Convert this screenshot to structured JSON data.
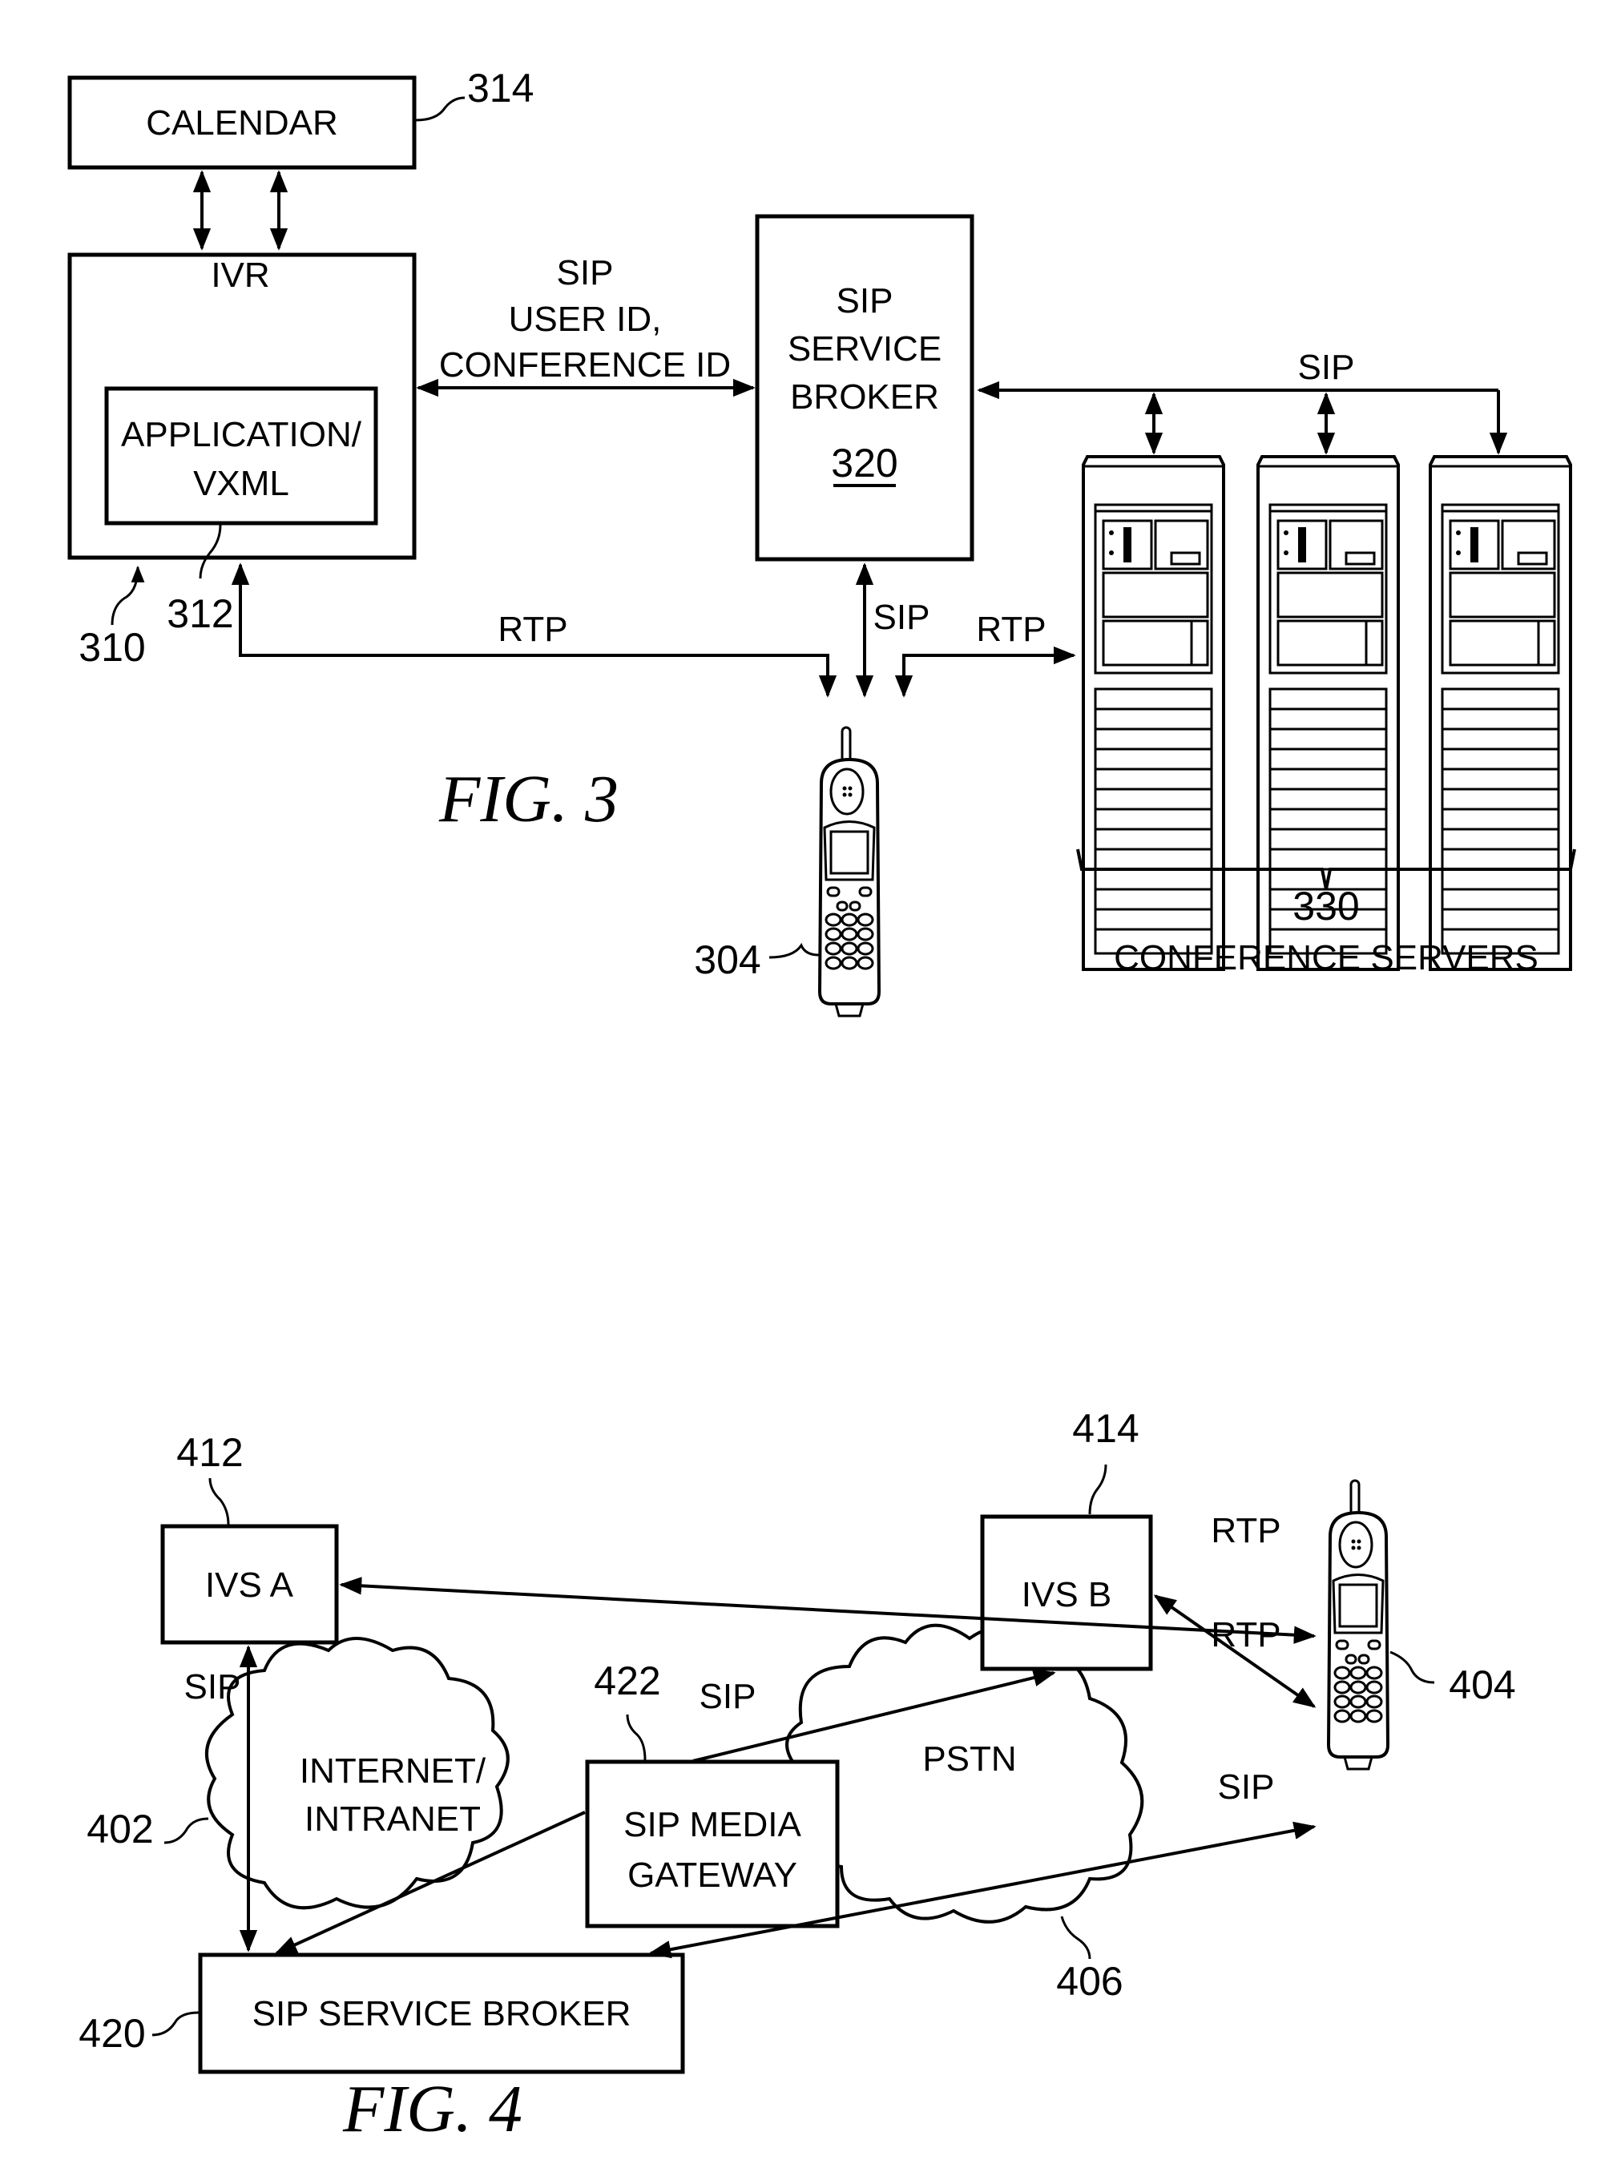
{
  "fig3": {
    "caption": "FIG. 3",
    "calendar": {
      "label": "CALENDAR",
      "ref": "314"
    },
    "ivr": {
      "title": "IVR",
      "ref": "310",
      "app_line1": "APPLICATION/",
      "app_line2": "VXML",
      "app_ref": "312"
    },
    "ivr_broker_link": {
      "line1": "SIP",
      "line2": "USER ID,",
      "line3": "CONFERENCE ID"
    },
    "broker": {
      "line1": "SIP",
      "line2": "SERVICE",
      "line3": "BROKER",
      "ref": "320"
    },
    "broker_servers_link": "SIP",
    "rtp_ivr_label": "RTP",
    "sip_phone_label": "SIP",
    "rtp_servers_label": "RTP",
    "phone": {
      "ref": "304"
    },
    "servers": {
      "ref": "330",
      "label": "CONFERENCE SERVERS",
      "count": 3
    }
  },
  "fig4": {
    "caption": "FIG. 4",
    "ivs_a": {
      "label": "IVS A",
      "ref": "412"
    },
    "ivs_b": {
      "label": "IVS B",
      "ref": "414"
    },
    "internet": {
      "line1": "INTERNET/",
      "line2": "INTRANET",
      "ref": "402"
    },
    "pstn": {
      "label": "PSTN",
      "ref": "406"
    },
    "gateway": {
      "line1": "SIP MEDIA",
      "line2": "GATEWAY",
      "ref": "422"
    },
    "broker": {
      "label": "SIP SERVICE BROKER",
      "ref": "420"
    },
    "phone": {
      "ref": "404"
    },
    "links": {
      "sip_ivs_a": "SIP",
      "sip_gateway_ivsb": "SIP",
      "rtp_ivsb_phone": "RTP",
      "rtp_ivsa_phone": "RTP",
      "sip_broker_phone": "SIP"
    }
  }
}
